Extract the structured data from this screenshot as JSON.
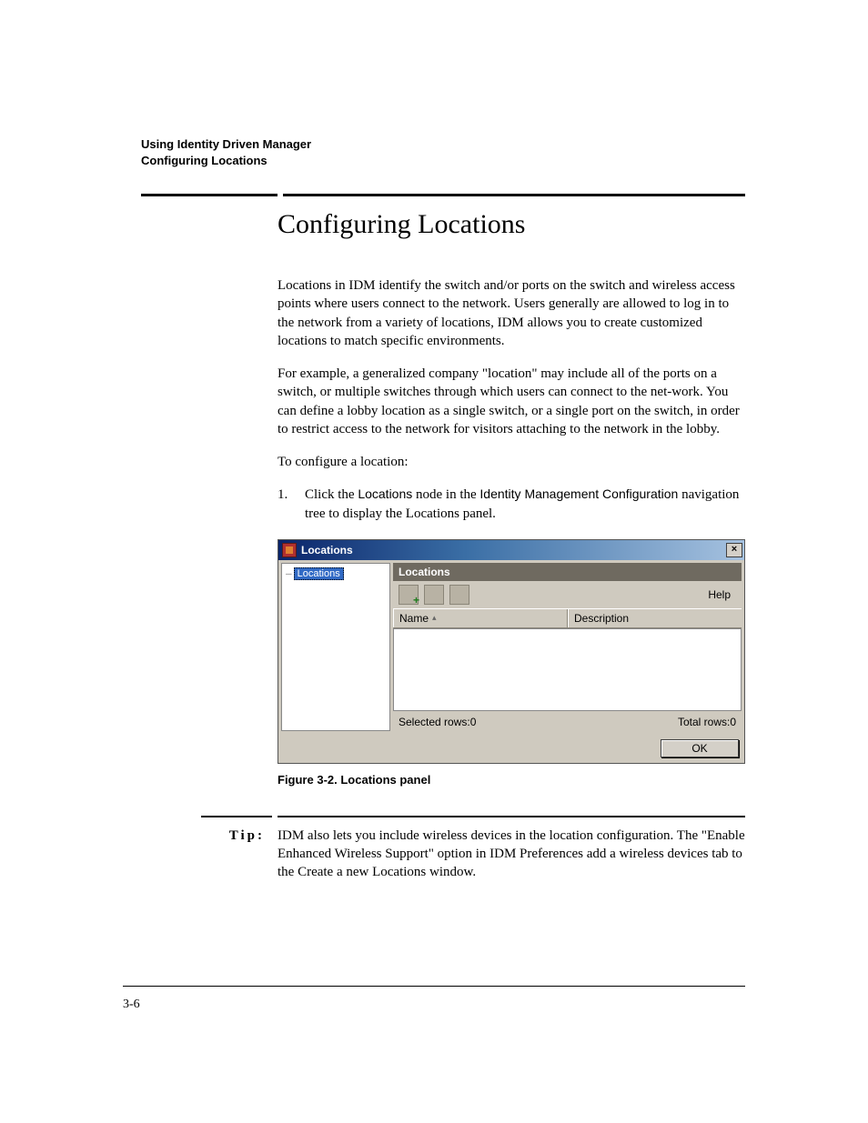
{
  "running_head": {
    "line1": "Using Identity Driven Manager",
    "line2": "Configuring Locations"
  },
  "section_title": "Configuring Locations",
  "para1": "Locations in IDM identify the switch and/or ports on the switch and wireless access points where users connect to the network. Users generally are allowed to log in to the network from a variety of locations, IDM allows you to create customized locations to match specific environments.",
  "para2": "For example, a generalized company \"location\" may include all of the ports on a switch, or multiple switches through which users can connect to the net-work. You can define a lobby location as a single switch, or a single port on the switch, in order to restrict access to the network for visitors attaching to the network in the lobby.",
  "para3": "To configure a location:",
  "step1_num": "1.",
  "step1_a": "Click the ",
  "step1_b": "Locations",
  "step1_c": " node in the ",
  "step1_d": "Identity Management Configuration",
  "step1_e": " navigation tree to display the Locations panel.",
  "panel": {
    "title": "Locations",
    "close": "×",
    "tree_node": "Locations",
    "detail_header": "Locations",
    "help": "Help",
    "col_name": "Name",
    "sort_ind": "▴",
    "col_desc": "Description",
    "selected": "Selected rows:0",
    "total": "Total rows:0",
    "ok": "OK"
  },
  "figure_caption": "Figure 3-2. Locations panel",
  "tip_label": "Tip:",
  "tip_text": "IDM also lets you include wireless devices in the location configuration. The \"Enable Enhanced Wireless Support\" option in IDM Preferences add a wireless devices tab to the Create a new Locations window.",
  "page_number": "3-6"
}
